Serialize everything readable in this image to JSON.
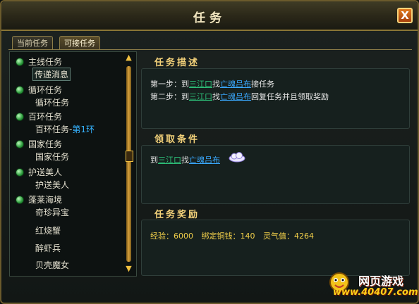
{
  "window": {
    "title": "任务",
    "close_label": "X"
  },
  "tabs": [
    {
      "label": "当前任务",
      "active": false
    },
    {
      "label": "可接任务",
      "active": true
    }
  ],
  "quest_list": {
    "categories": [
      {
        "label": "主线任务",
        "items": [
          "传递消息"
        ]
      },
      {
        "label": "循环任务",
        "items": [
          "循环任务"
        ]
      },
      {
        "label": "百环任务",
        "items": [
          "百环任务-"
        ],
        "item_suffix": "第1环"
      },
      {
        "label": "国家任务",
        "items": [
          "国家任务"
        ]
      },
      {
        "label": "护送美人",
        "items": [
          "护送美人"
        ]
      },
      {
        "label": "蓬莱海境",
        "items": [
          "奇珍异宝",
          "红烧蟹",
          "醉虾兵",
          "贝壳魔女"
        ]
      }
    ],
    "selected": "传递消息"
  },
  "description": {
    "heading": "任务描述",
    "step1": {
      "prefix": "第一步：到",
      "place": "三江口",
      "mid": "找",
      "npc": "亡魂吕布",
      "suffix": "接任务"
    },
    "step2": {
      "prefix": "第二步：到",
      "place": "三江口",
      "mid": "找",
      "npc": "亡魂吕布",
      "suffix": "回复任务并且领取奖励"
    }
  },
  "conditions": {
    "heading": "领取条件",
    "prefix": "到",
    "place": "三江口",
    "mid": "找",
    "npc": "亡魂吕布",
    "icon": "cloud-icon"
  },
  "rewards": {
    "heading": "任务奖励",
    "exp_label": "经验：",
    "exp_value": "6000",
    "coin_label": "绑定铜钱：",
    "coin_value": "140",
    "spirit_label": "灵气值：",
    "spirit_value": "4264"
  },
  "watermark": {
    "line1": "网页游戏",
    "line2": "www.40407.com"
  },
  "colors": {
    "accent": "#f4d27a",
    "link_place": "#2ec27a",
    "link_npc": "#3aa9ff",
    "reward": "#f1cf4a",
    "highlight": "#35b3ff"
  }
}
